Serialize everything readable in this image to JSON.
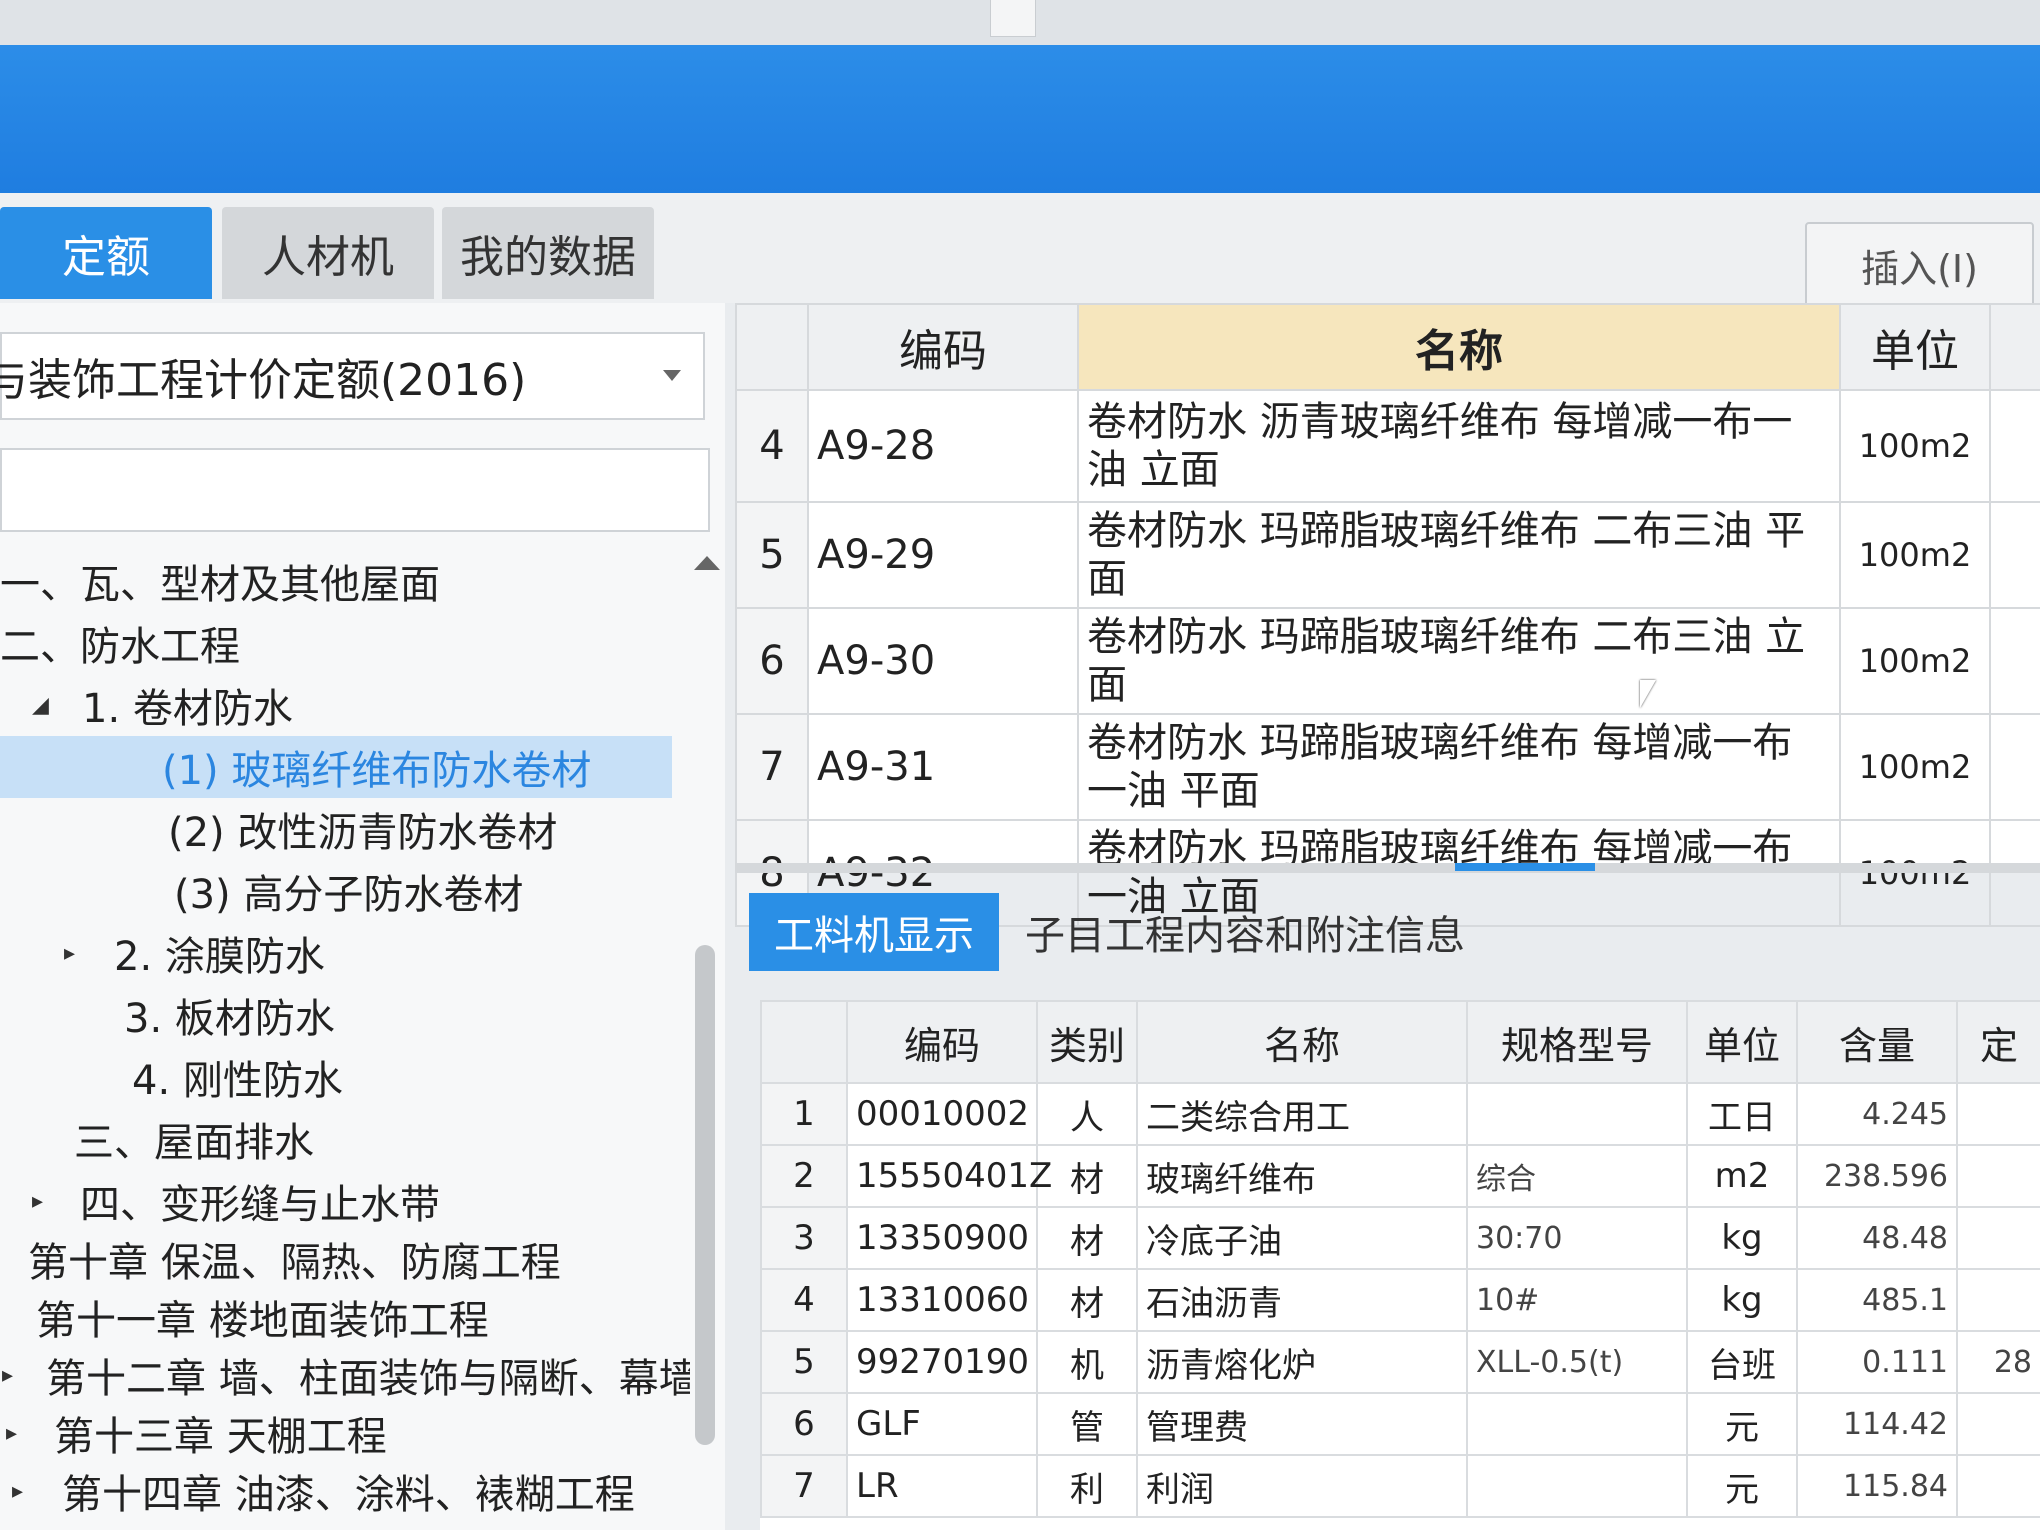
{
  "tabs": [
    {
      "label": "定额",
      "active": true
    },
    {
      "label": "人材机",
      "active": false
    },
    {
      "label": "我的数据",
      "active": false
    }
  ],
  "toolbar": {
    "insert_label": "插入(I)"
  },
  "library": {
    "selected": "与装饰工程计价定额(2016)"
  },
  "tree": [
    {
      "label": "一、瓦、型材及其他屋面",
      "toggle": ""
    },
    {
      "label": "二、防水工程",
      "toggle": ""
    },
    {
      "label": "1. 卷材防水",
      "toggle": "◢"
    },
    {
      "label": "(1) 玻璃纤维布防水卷材",
      "toggle": "",
      "selected": true
    },
    {
      "label": "(2) 改性沥青防水卷材",
      "toggle": ""
    },
    {
      "label": "(3) 高分子防水卷材",
      "toggle": ""
    },
    {
      "label": "2. 涂膜防水",
      "toggle": "▸"
    },
    {
      "label": "3. 板材防水",
      "toggle": ""
    },
    {
      "label": "4. 刚性防水",
      "toggle": ""
    },
    {
      "label": "三、屋面排水",
      "toggle": ""
    },
    {
      "label": "四、变形缝与止水带",
      "toggle": "▸"
    },
    {
      "label": "第十章 保温、隔热、防腐工程",
      "toggle": ""
    },
    {
      "label": "第十一章 楼地面装饰工程",
      "toggle": ""
    },
    {
      "label": "第十二章 墙、柱面装饰与隔断、幕墙...",
      "toggle": "▸"
    },
    {
      "label": "第十三章 天棚工程",
      "toggle": "▸"
    },
    {
      "label": "第十四章 油漆、涂料、裱糊工程",
      "toggle": "▸"
    }
  ],
  "quota_table": {
    "headers": {
      "code": "编码",
      "name": "名称",
      "unit": "单位"
    },
    "rows": [
      {
        "no": "4",
        "code": "A9-28",
        "name": "卷材防水 沥青玻璃纤维布 每增减一布一油 立面",
        "unit": "100m2"
      },
      {
        "no": "5",
        "code": "A9-29",
        "name": "卷材防水 玛蹄脂玻璃纤维布 二布三油 平面",
        "unit": "100m2"
      },
      {
        "no": "6",
        "code": "A9-30",
        "name": "卷材防水 玛蹄脂玻璃纤维布 二布三油 立面",
        "unit": "100m2"
      },
      {
        "no": "7",
        "code": "A9-31",
        "name": "卷材防水 玛蹄脂玻璃纤维布 每增减一布一油 平面",
        "unit": "100m2"
      },
      {
        "no": "8",
        "code": "A9-32",
        "name": "卷材防水 玛蹄脂玻璃纤维布 每增减一布一油 立面",
        "unit": "100m2"
      }
    ]
  },
  "detail_tabs": [
    {
      "label": "工料机显示",
      "active": true
    },
    {
      "label": "子目工程内容和附注信息",
      "active": false
    }
  ],
  "resource_table": {
    "headers": {
      "code": "编码",
      "type": "类别",
      "name": "名称",
      "spec": "规格型号",
      "unit": "单位",
      "qty": "含量",
      "extra": "定"
    },
    "rows": [
      {
        "no": "1",
        "code": "00010002",
        "type": "人",
        "name": "二类综合用工",
        "spec": "",
        "unit": "工日",
        "qty": "4.245",
        "extra": ""
      },
      {
        "no": "2",
        "code": "15550401Z",
        "type": "材",
        "name": "玻璃纤维布",
        "spec": "综合",
        "unit": "m2",
        "qty": "238.596",
        "extra": ""
      },
      {
        "no": "3",
        "code": "13350900",
        "type": "材",
        "name": "冷底子油",
        "spec": "30:70",
        "unit": "kg",
        "qty": "48.48",
        "extra": ""
      },
      {
        "no": "4",
        "code": "13310060",
        "type": "材",
        "name": "石油沥青",
        "spec": "10#",
        "unit": "kg",
        "qty": "485.1",
        "extra": ""
      },
      {
        "no": "5",
        "code": "99270190",
        "type": "机",
        "name": "沥青熔化炉",
        "spec": "XLL-0.5(t)",
        "unit": "台班",
        "qty": "0.111",
        "extra": "28"
      },
      {
        "no": "6",
        "code": "GLF",
        "type": "管",
        "name": "管理费",
        "spec": "",
        "unit": "元",
        "qty": "114.42",
        "extra": ""
      },
      {
        "no": "7",
        "code": "LR",
        "type": "利",
        "name": "利润",
        "spec": "",
        "unit": "元",
        "qty": "115.84",
        "extra": ""
      }
    ]
  }
}
